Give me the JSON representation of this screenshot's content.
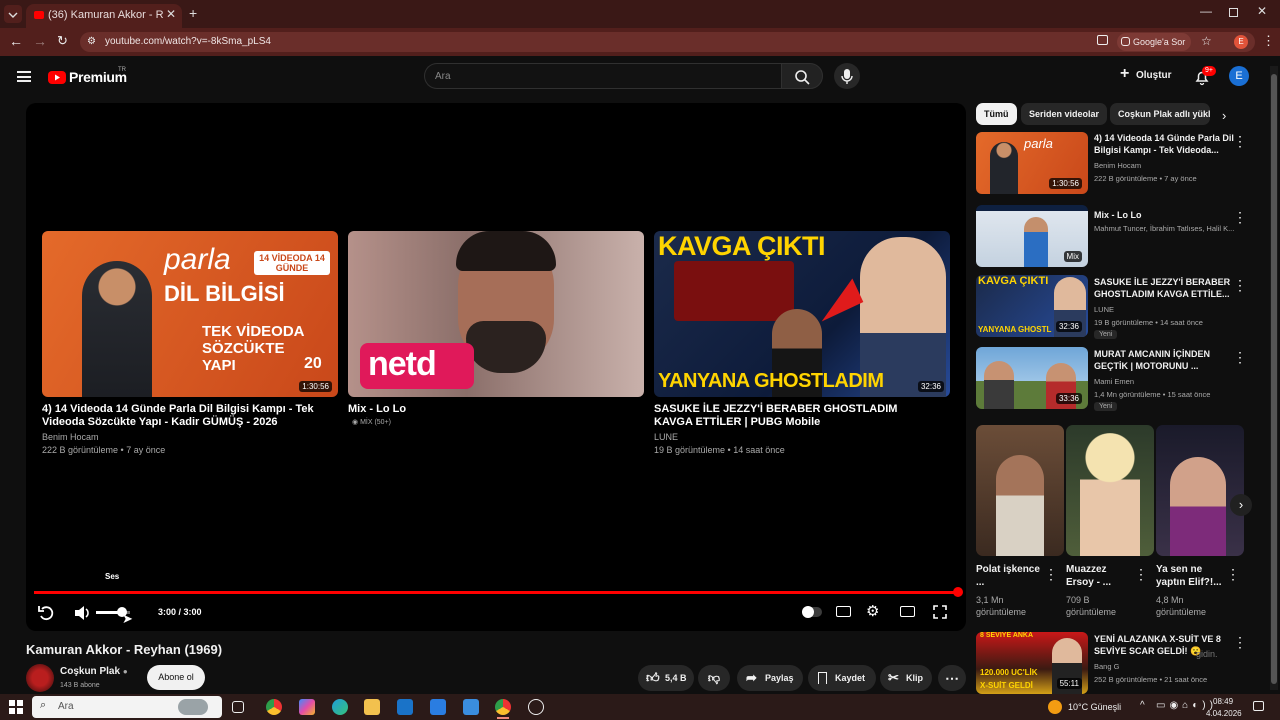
{
  "browser": {
    "tab_title": "(36) Kamuran Akkor - Reyhan (",
    "url": "youtube.com/watch?v=-8kSma_pLS4",
    "google_ask": "Google'a Sor",
    "profile_initial": "E"
  },
  "header": {
    "logo_text": "Premium",
    "region": "TR",
    "search_placeholder": "Ara",
    "create_label": "Oluştur",
    "notif_count": "9+",
    "avatar_initial": "E"
  },
  "player": {
    "volume_tooltip": "Ses",
    "time": "3:00 / 3:00",
    "progress": 1.0,
    "volume_level": 0.75,
    "end_cards": [
      {
        "thumb_text_1": "parla",
        "thumb_text_2": "DİL BİLGİSİ",
        "thumb_text_3": "TEK VİDEODA SÖZCÜKTE YAPI",
        "thumb_badge": "14 VİDEODA 14 GÜNDE",
        "thumb_num": "20",
        "duration": "1:30:56",
        "title": "4) 14 Videoda 14 Günde Parla Dil Bilgisi Kampı - Tek Videoda Sözcükte Yapı - Kadir GÜMÜŞ - 2026",
        "channel": "Benim Hocam",
        "meta": "222 B görüntüleme • 7 ay önce"
      },
      {
        "thumb_logo": "netd",
        "title": "Mix - Lo Lo",
        "mix_label": "MİX (50+)"
      },
      {
        "thumb_text_1": "KAVGA ÇIKTI",
        "thumb_text_2": "YANYANA GHOSTLADIM",
        "duration": "32:36",
        "title": "SASUKE İLE JEZZY'İ BERABER GHOSTLADIM KAVGA ETTİLER | PUBG Mobile",
        "channel": "LUNE",
        "meta": "19 B görüntüleme • 14 saat önce"
      }
    ]
  },
  "video": {
    "title": "Kamuran Akkor - Reyhan (1969)",
    "channel": "Coşkun Plak",
    "subs": "143 B abone",
    "subscribe_label": "Abone ol",
    "likes": "5,4 B",
    "share_label": "Paylaş",
    "save_label": "Kaydet",
    "clip_label": "Klip"
  },
  "chips": [
    "Tümü",
    "Seriden videolar",
    "Coşkun Plak adlı yükl"
  ],
  "related": [
    {
      "title": "4) 14 Videoda 14 Günde Parla Dil Bilgisi Kampı - Tek Videoda...",
      "channel": "Benim Hocam",
      "meta": "222 B görüntüleme • 7 ay önce",
      "duration": "1:30:56"
    },
    {
      "title": "Mix - Lo Lo",
      "channel": "Mahmut Tuncer, İbrahim Tatlıses, Halil K...",
      "meta": "",
      "duration": "Mix"
    },
    {
      "title": "SASUKE İLE JEZZY'İ BERABER GHOSTLADIM KAVGA ETTİLE...",
      "channel": "LUNE",
      "meta": "19 B görüntüleme • 14 saat önce",
      "duration": "32:36",
      "badge": "Yeni"
    },
    {
      "title": "MURAT AMCANIN İÇİNDEN GEÇTİK | MOTORUNU ...",
      "channel": "Mami Emen",
      "meta": "1,4 Mn görüntüleme • 15 saat önce",
      "duration": "33:36",
      "badge": "Yeni"
    }
  ],
  "shorts": [
    {
      "title": "Polat işkence ...",
      "views": "3,1 Mn görüntüleme"
    },
    {
      "title": "Muazzez Ersoy - ...",
      "views": "709 B görüntüleme"
    },
    {
      "title": "Ya sen ne yaptın Elif?!...",
      "views": "4,8 Mn görüntüleme"
    }
  ],
  "related_last": {
    "title": "YENİ ALAZANKA X-SUİT VE 8 SEVİYE SCAR GELDİ! 😮",
    "channel": "Bang G",
    "meta": "252 B görüntüleme • 21 saat önce",
    "duration": "55:11",
    "thumb_text_1": "8 SEVİYE ANKA",
    "thumb_text_2": "120.000 UC'LİK",
    "thumb_text_3": "X-SUİT GELDİ"
  },
  "overlay_hint": "gidin.",
  "taskbar": {
    "search_placeholder": "Ara",
    "weather": "10°C  Güneşli",
    "time": "08:49",
    "date": "4.04.2026"
  },
  "colors": {
    "accent": "#ff0000",
    "browser_bg": "#521f1c",
    "bg": "#0f0f0f"
  }
}
